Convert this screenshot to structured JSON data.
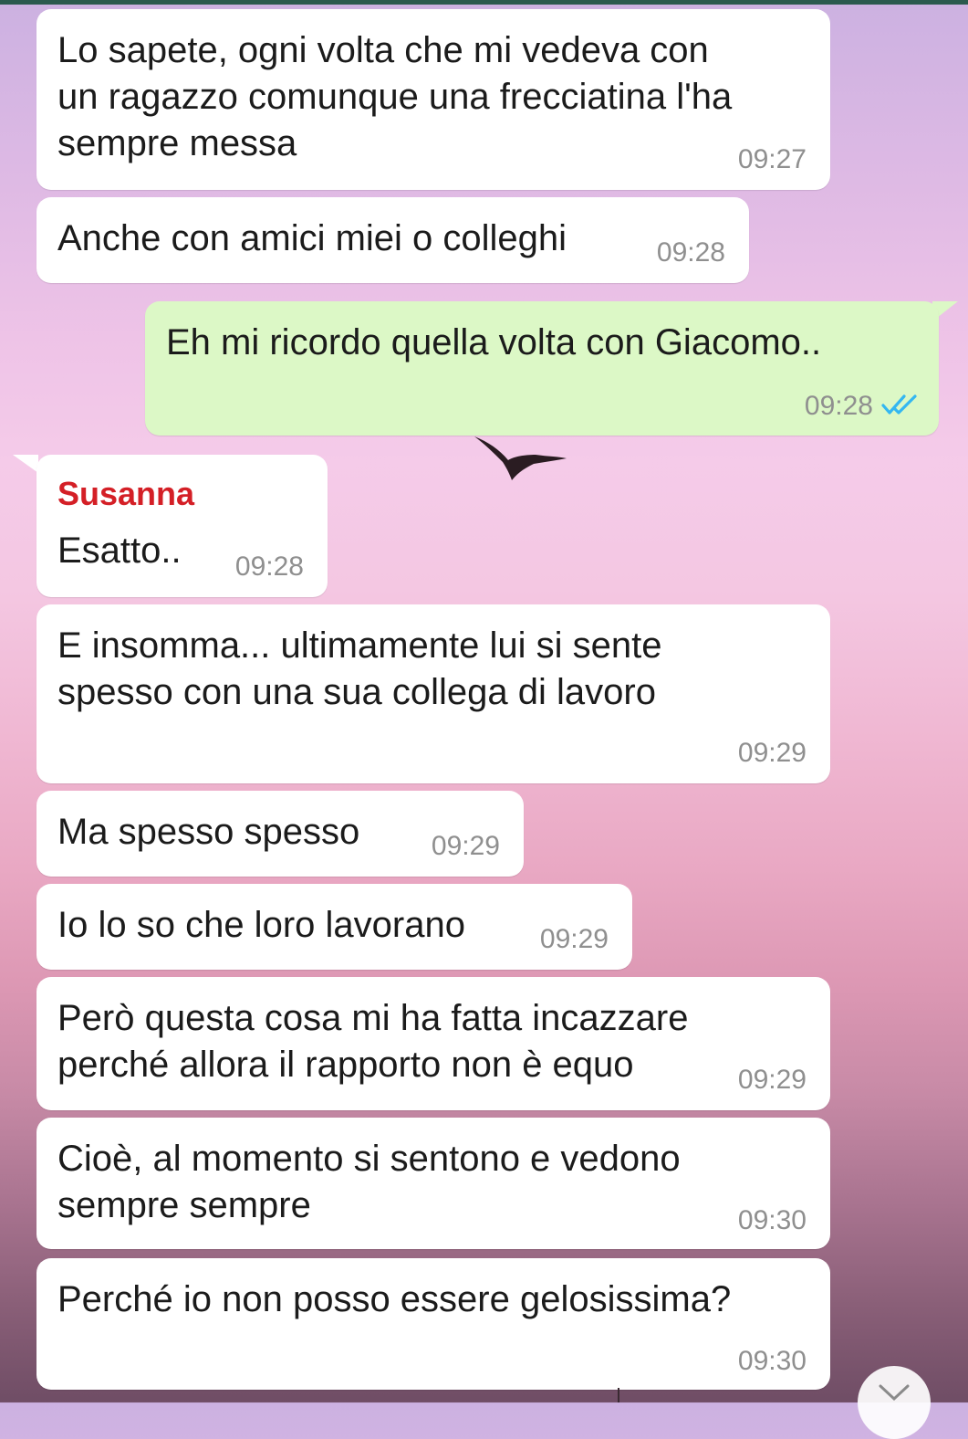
{
  "chat": {
    "messages": [
      {
        "text": "Lo sapete, ogni volta che mi vedeva con\nun ragazzo comunque una frecciatina l'ha\nsempre messa",
        "time": "09:27"
      },
      {
        "text": "Anche con amici miei o colleghi",
        "time": "09:28"
      },
      {
        "text": "Eh mi ricordo quella volta con Giacomo..",
        "time": "09:28",
        "outgoing": true,
        "status": "read"
      },
      {
        "sender": "Susanna",
        "text": "Esatto..",
        "time": "09:28"
      },
      {
        "text": "E insomma... ultimamente lui si sente\nspesso con una sua collega di lavoro",
        "time": "09:29"
      },
      {
        "text": "Ma spesso spesso",
        "time": "09:29"
      },
      {
        "text": "Io lo so che loro lavorano",
        "time": "09:29"
      },
      {
        "text": "Però questa cosa mi ha fatta incazzare\nperché allora il rapporto non è equo",
        "time": "09:29"
      },
      {
        "text": "Cioè, al momento si sentono e vedono\nsempre sempre",
        "time": "09:30"
      },
      {
        "text": "Perché io non posso essere gelosissima?",
        "time": "09:30"
      }
    ]
  },
  "colors": {
    "outgoing_bubble": "#dcf8c6",
    "incoming_bubble": "#ffffff",
    "sender_name": "#d41f26",
    "read_ticks": "#34b7f1",
    "timestamp": "#8f8f8f"
  },
  "icons": {
    "read_receipt": "double-check-icon",
    "scroll_down": "chevron-down-icon",
    "wallpaper_bird": "bird-silhouette"
  }
}
